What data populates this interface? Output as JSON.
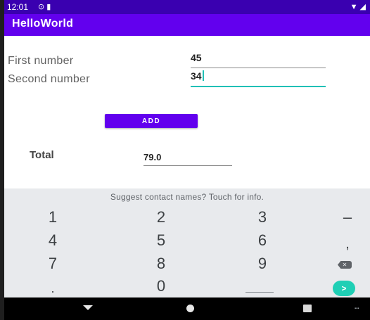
{
  "status_bar": {
    "time": "12:01",
    "left_icons": [
      "cast-icon",
      "sd-card-icon"
    ],
    "right_icons": [
      "wifi-icon",
      "signal-icon"
    ]
  },
  "app_bar": {
    "title": "HelloWorld"
  },
  "form": {
    "first_label": "First number",
    "first_value": "45",
    "second_label": "Second number",
    "second_value": "34",
    "add_label": "ADD",
    "total_label": "Total",
    "total_value": "79.0"
  },
  "keyboard": {
    "suggestion": "Suggest contact names? Touch for info.",
    "rows": [
      [
        "1",
        "2",
        "3",
        "–"
      ],
      [
        "4",
        "5",
        "6",
        ","
      ],
      [
        "7",
        "8",
        "9",
        "⌫"
      ],
      [
        ".",
        "0",
        "space",
        "go"
      ]
    ],
    "go_label": ">",
    "accent": "#1fcfb5"
  },
  "theme": {
    "primary": "#6200ee",
    "status_bar": "#3a00b0",
    "focus": "#21c0b6"
  }
}
